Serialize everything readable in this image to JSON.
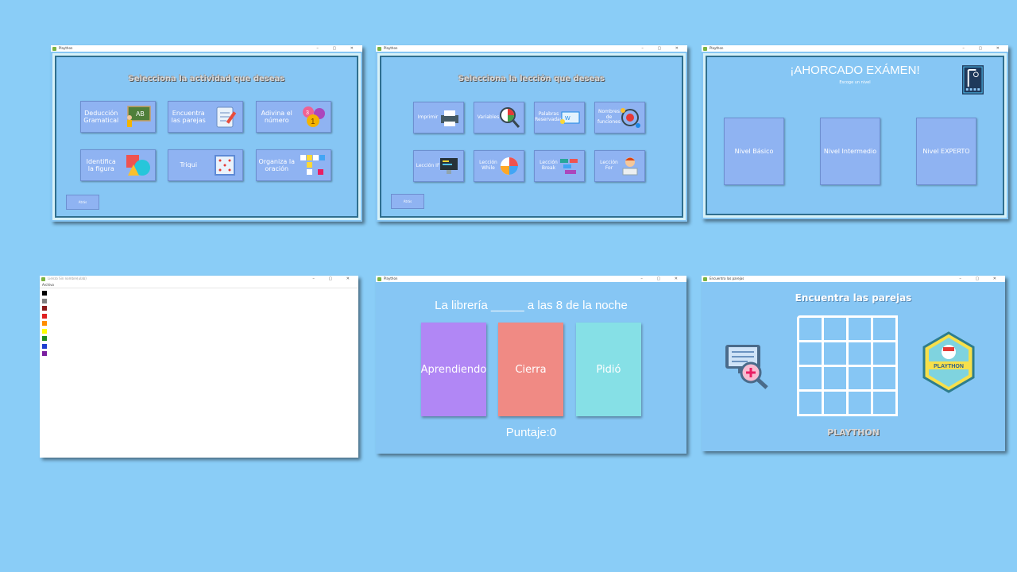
{
  "windows": {
    "activities": {
      "title": "Plaython",
      "heading": "Selecciona la actividad que deseas",
      "cards": [
        {
          "label": "Deducción Gramatical",
          "icon": "blackboard-teacher-icon"
        },
        {
          "label": "Encuentra las parejas",
          "icon": "clipboard-pencil-icon"
        },
        {
          "label": "Adivina el número",
          "icon": "number-balloons-icon"
        },
        {
          "label": "Identifica la figura",
          "icon": "shapes-icon"
        },
        {
          "label": "Triqui",
          "icon": "tictactoe-board-icon"
        },
        {
          "label": "Organiza la oración",
          "icon": "letter-blocks-icon"
        }
      ],
      "back_label": "Atrás"
    },
    "lessons": {
      "title": "Plaython",
      "heading": "Selecciona la lección que deseas",
      "cards": [
        {
          "label": "Imprimir",
          "icon": "printer-icon"
        },
        {
          "label": "Variables",
          "icon": "magnifier-chart-icon"
        },
        {
          "label": "Palabras Reservadas",
          "icon": "keyboard-icon"
        },
        {
          "label": "Nombres de funciones",
          "icon": "target-gears-icon"
        },
        {
          "label": "Lección IF",
          "icon": "monitor-code-icon"
        },
        {
          "label": "Lección While",
          "icon": "cycle-arrows-icon"
        },
        {
          "label": "Lección Break",
          "icon": "blocks-icon"
        },
        {
          "label": "Lección For",
          "icon": "student-laptop-icon"
        }
      ],
      "back_label": "Atrás"
    },
    "hangman": {
      "title": "Plaython",
      "heading": "¡AHORCADO EXÁMEN!",
      "subheading": "Escoge un nivel",
      "levels": [
        "Nivel Básico",
        "Nivel Intermedio",
        "Nivel EXPERTO"
      ],
      "icon": "gallows-icon"
    },
    "paint": {
      "title": "Lienzo Sin nombre(ulab)",
      "menu": "Archivo",
      "colors": [
        "#000000",
        "#7f7f7f",
        "#8b1a1a",
        "#e02020",
        "#ff8c00",
        "#ffff00",
        "#1e8c1e",
        "#1f3fd0",
        "#7a1fa0"
      ]
    },
    "quiz": {
      "title": "Plaython",
      "question": "La librería _____ a las 8 de la noche",
      "answers": [
        {
          "label": "Aprendiendo",
          "color": "#b187f5"
        },
        {
          "label": "Cierra",
          "color": "#f08a84"
        },
        {
          "label": "Pidió",
          "color": "#86e0e6"
        }
      ],
      "score": "Puntaje:0"
    },
    "pairs": {
      "title": "Encuentra las parejas",
      "heading": "Encuentra las parejas",
      "footer": "PLAYTHON",
      "badge_title": "PLAYTHON",
      "left_icon": "monitor-magnifier-icon"
    }
  }
}
